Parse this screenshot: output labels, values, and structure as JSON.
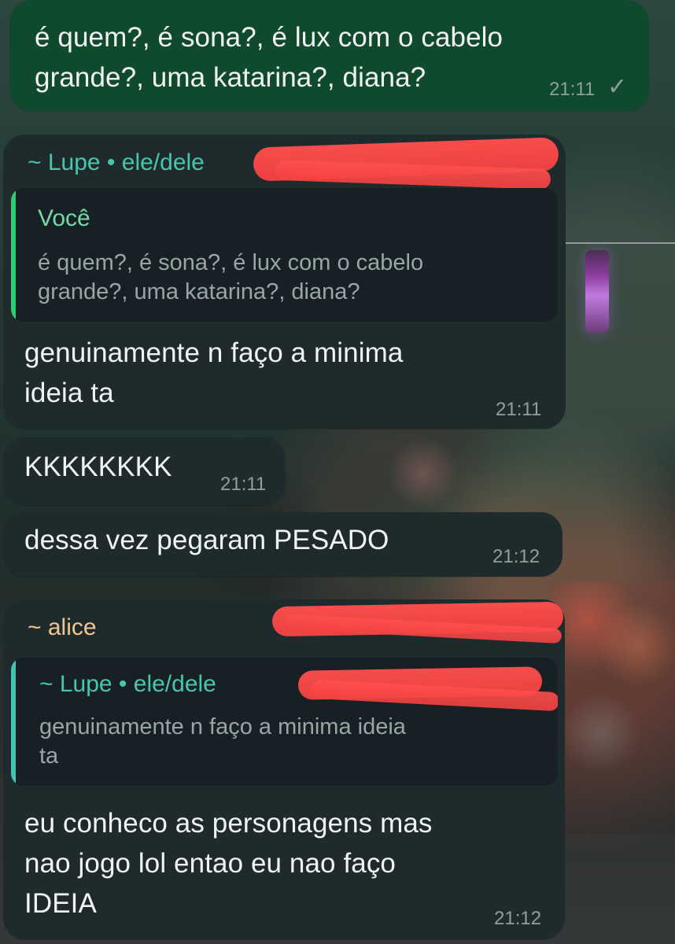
{
  "colors": {
    "outgoing_bubble": "#0f4a2d",
    "incoming_bubble": "#1f2a2d",
    "lupe_name": "#46c7ad",
    "alice_name": "#f3c58e",
    "reply_green": "#2ecc71",
    "reply_teal": "#42c5b4",
    "time_text": "#8fa09c",
    "redaction": "#f44242"
  },
  "messages": [
    {
      "type": "outgoing",
      "text": "é quem?, é sona?, é lux com o cabelo\ngrande?, uma katarina?, diana?",
      "time": "21:11",
      "status_icon": "✓"
    },
    {
      "type": "incoming",
      "sender": "~ Lupe • ele/dele",
      "reply": {
        "name": "Você",
        "snippet": "é quem?, é sona?, é lux com o cabelo\ngrande?, uma katarina?, diana?"
      },
      "text": "genuinamente n faço a minima\nideia ta",
      "time": "21:11"
    },
    {
      "type": "incoming",
      "text": "KKKKKKKK",
      "time": "21:11"
    },
    {
      "type": "incoming",
      "text": "dessa vez pegaram PESADO",
      "time": "21:12"
    },
    {
      "type": "incoming",
      "sender": "~ alice",
      "reply": {
        "name": "~ Lupe • ele/dele",
        "snippet": "genuinamente n faço a minima ideia\nta"
      },
      "text": "eu conheco as personagens mas\nnao jogo lol entao eu nao faço\nIDEIA",
      "time": "21:12"
    }
  ]
}
